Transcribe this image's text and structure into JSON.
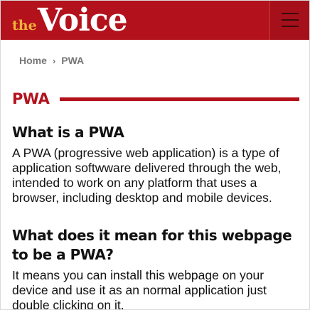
{
  "header": {
    "logo_the": "the",
    "logo_voice": "Voice",
    "menu_icon": "hamburger-menu-icon",
    "brand_color": "#b3121d",
    "logo_accent_color": "#f1b23a"
  },
  "breadcrumb": {
    "home": "Home",
    "separator": "›",
    "current": "PWA"
  },
  "section": {
    "title": "PWA",
    "accent_color": "#b3121d"
  },
  "article": {
    "heading1": "What is a PWA",
    "paragraph1": "A PWA (progressive web application) is a type of application softwware delivered through the web, intended to work on any platform that uses a browser, including desktop and mobile devices.",
    "heading2": "What does it mean for this webpage to be a PWA?",
    "paragraph2": "It means you can install this webpage on your device and use it as an normal application just double clicking on it."
  }
}
